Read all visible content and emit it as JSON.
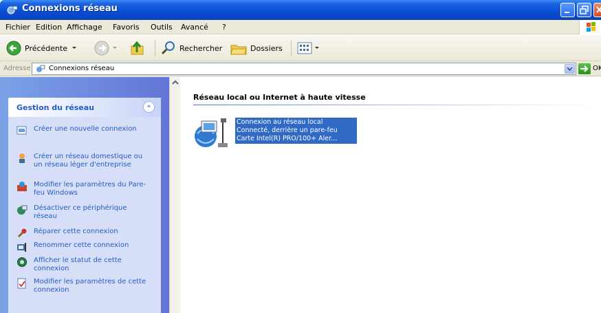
{
  "window": {
    "title": "Connexions réseau"
  },
  "menu": {
    "items": [
      "Fichier",
      "Edition",
      "Affichage",
      "Favoris",
      "Outils",
      "Avancé",
      "?"
    ]
  },
  "toolbar": {
    "back_label": "Précédente",
    "search_label": "Rechercher",
    "folders_label": "Dossiers"
  },
  "address": {
    "label": "Adresse",
    "value": "Connexions réseau",
    "go_label": "OK"
  },
  "tasks_panel": {
    "title": "Gestion du réseau",
    "collapse_glyph": "«",
    "items": [
      {
        "label": "Créer une nouvelle connexion",
        "icon": "new-connection-icon"
      },
      {
        "label": "Créer un réseau domestique ou un réseau léger d'entreprise",
        "icon": "home-network-icon"
      },
      {
        "label": "Modifier les paramètres du Pare-feu Windows",
        "icon": "firewall-icon"
      },
      {
        "label": "Désactiver ce périphérique réseau",
        "icon": "disable-device-icon"
      },
      {
        "label": "Réparer cette connexion",
        "icon": "repair-icon"
      },
      {
        "label": "Renommer cette connexion",
        "icon": "rename-icon"
      },
      {
        "label": "Afficher le statut de cette connexion",
        "icon": "status-icon"
      },
      {
        "label": "Modifier les paramètres de cette connexion",
        "icon": "properties-icon"
      }
    ]
  },
  "content": {
    "group_title": "Réseau local ou Internet à haute vitesse",
    "connection": {
      "name": "Connexion au réseau local",
      "status": "Connecté, derrière un pare-feu",
      "device": "Carte Intel(R) PRO/100+ Aler..."
    }
  },
  "colors": {
    "titlebar": "#0a52d8",
    "task_link": "#215dc6",
    "selection": "#316ac5"
  }
}
